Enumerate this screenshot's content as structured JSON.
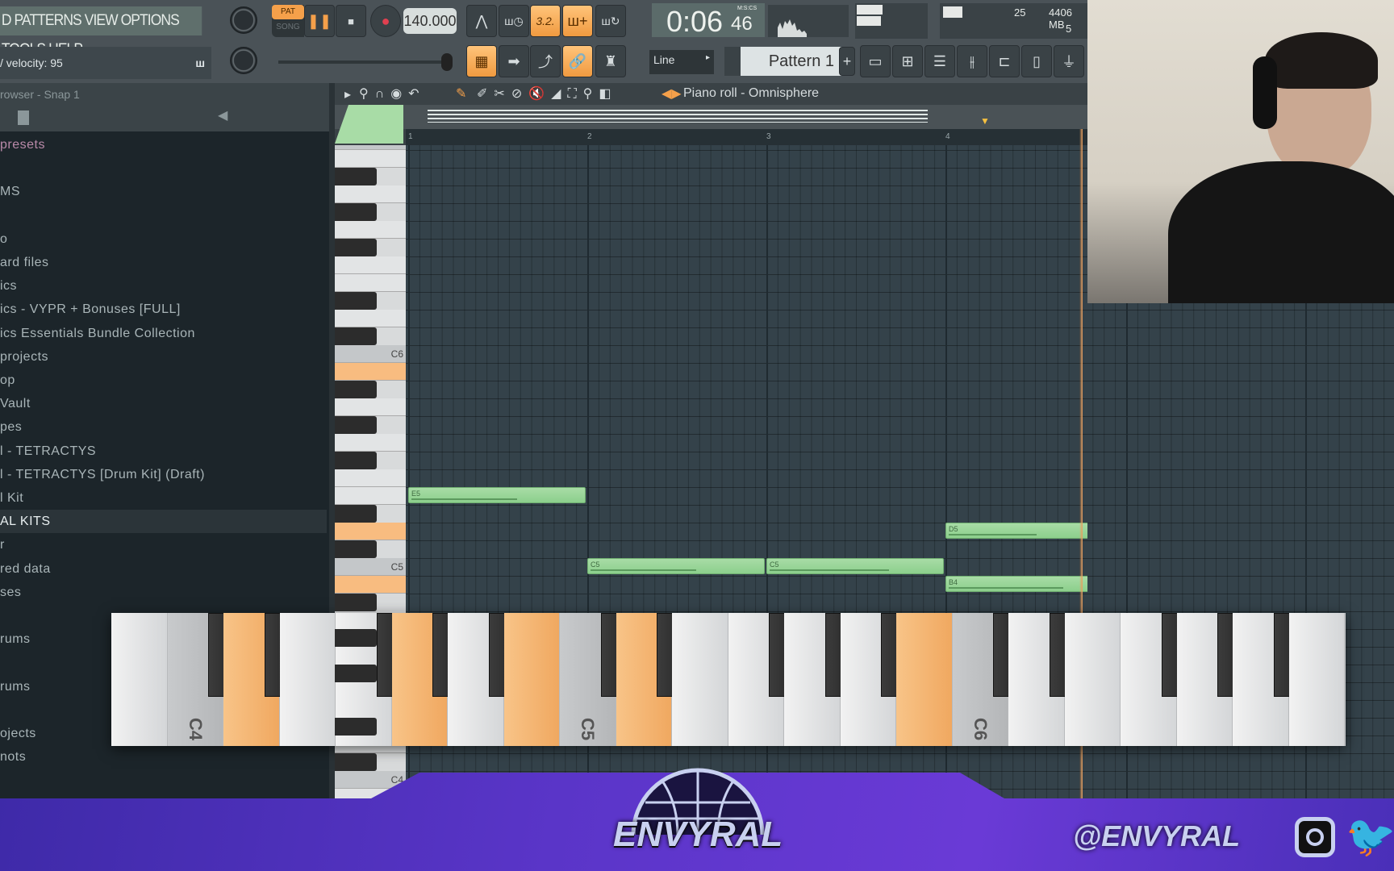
{
  "toolbar": {
    "menu": "D PATTERNS VIEW OPTIONS TOOLS HELP",
    "pat_label": "PAT",
    "song_label": "SONG",
    "tempo": "140.000",
    "time": "0:06",
    "time_cs": "46",
    "time_format": "M:S:CS",
    "cpu": "25",
    "memory": "4406 MB",
    "polyphony": "5",
    "hint": "/ velocity: 95",
    "snap": "Line",
    "pattern": "Pattern 1",
    "accent": "#f5a04a"
  },
  "browser": {
    "header": "rowser - Snap 1",
    "items": [
      {
        "label": "presets",
        "style": "pink"
      },
      {
        "label": ""
      },
      {
        "label": "MS"
      },
      {
        "label": ""
      },
      {
        "label": "o"
      },
      {
        "label": "ard files"
      },
      {
        "label": "ics"
      },
      {
        "label": "ics - VYPR + Bonuses [FULL]"
      },
      {
        "label": "ics Essentials Bundle Collection"
      },
      {
        "label": "projects"
      },
      {
        "label": "op"
      },
      {
        "label": "Vault"
      },
      {
        "label": "pes"
      },
      {
        "label": "l - TETRACTYS"
      },
      {
        "label": "l - TETRACTYS [Drum Kit] (Draft)"
      },
      {
        "label": "l Kit"
      },
      {
        "label": "AL KITS",
        "style": "sel"
      },
      {
        "label": "r"
      },
      {
        "label": "red data"
      },
      {
        "label": "ses"
      },
      {
        "label": ""
      },
      {
        "label": "rums"
      },
      {
        "label": ""
      },
      {
        "label": "rums"
      },
      {
        "label": ""
      },
      {
        "label": "ojects"
      },
      {
        "label": "nots"
      }
    ]
  },
  "piano_roll": {
    "title": "Piano roll - Omnisphere",
    "bars": [
      "1",
      "2",
      "3",
      "4"
    ],
    "key_labels": [
      "C6",
      "C5",
      "C4"
    ],
    "notes": [
      {
        "label": "E5",
        "pitch": 76,
        "start": 0,
        "length": 1,
        "velocity": 0.6
      },
      {
        "label": "C5",
        "pitch": 72,
        "start": 1,
        "length": 1,
        "velocity": 0.6
      },
      {
        "label": "C5",
        "pitch": 72,
        "start": 2,
        "length": 1,
        "velocity": 0.68
      },
      {
        "label": "D5",
        "pitch": 74,
        "start": 3,
        "length": 1,
        "velocity": 0.5
      },
      {
        "label": "B4",
        "pitch": 71,
        "start": 3,
        "length": 1,
        "velocity": 0.65
      }
    ],
    "highlighted_pitches": [
      83,
      74,
      71
    ]
  },
  "keyboard_overlay": {
    "labels": {
      "C4": "C4",
      "C5": "C5",
      "C6": "C6"
    },
    "highlighted": [
      "D4",
      "G4",
      "B4",
      "D5",
      "B5"
    ]
  },
  "overlay": {
    "brand": "ENVYRAL",
    "handle": "@ENVYRAL",
    "socials": [
      "instagram",
      "twitter"
    ]
  }
}
